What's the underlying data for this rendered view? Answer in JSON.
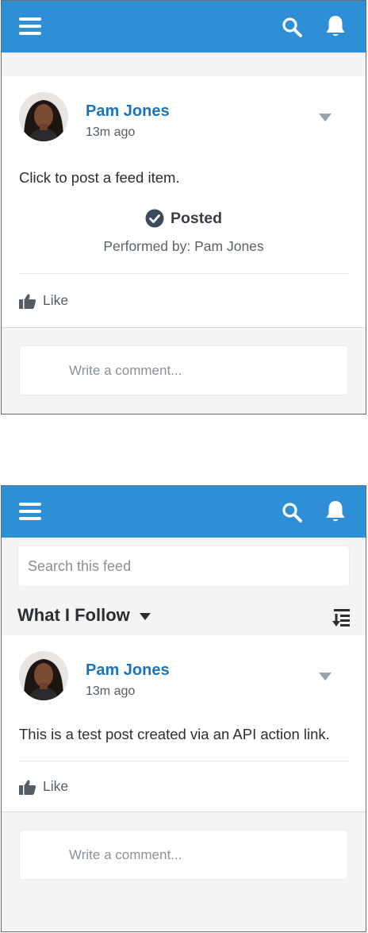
{
  "screens": [
    {
      "post": {
        "author": "Pam Jones",
        "timestamp": "13m ago",
        "body": "Click to post a feed item.",
        "status": "Posted",
        "performed_by": "Performed by: Pam Jones"
      },
      "like_label": "Like",
      "comment_placeholder": "Write a comment..."
    },
    {
      "search_placeholder": "Search this feed",
      "filter_label": "What I Follow",
      "post": {
        "author": "Pam Jones",
        "timestamp": "13m ago",
        "body": "This is a test post created via an API action link."
      },
      "like_label": "Like",
      "comment_placeholder": "Write a comment..."
    }
  ],
  "colors": {
    "header": "#2e8fd6",
    "author_link": "#1d73b6",
    "background": "#f4f4f4"
  },
  "icons": [
    "menu-icon",
    "search-icon",
    "bell-icon",
    "chevron-down-icon",
    "check-circle-icon",
    "thumbs-up-icon",
    "sort-icon"
  ]
}
